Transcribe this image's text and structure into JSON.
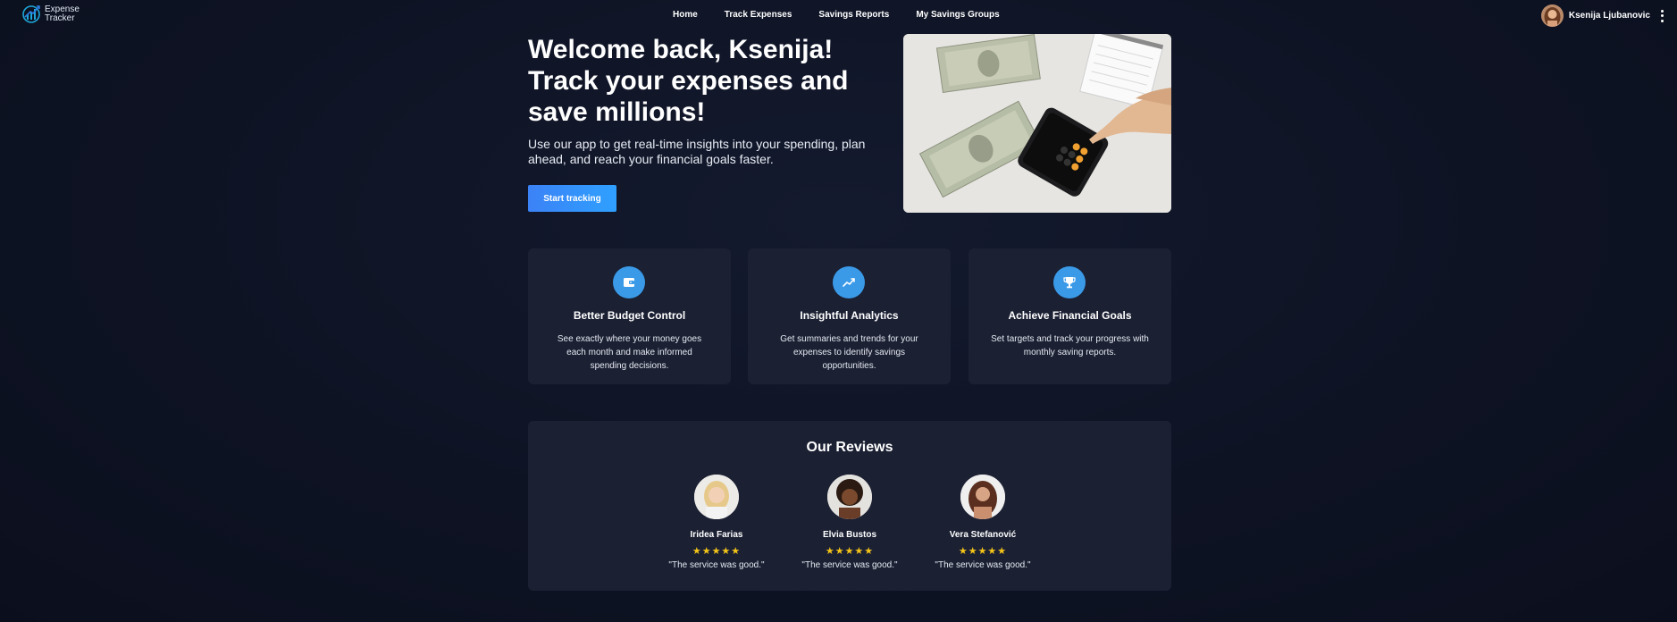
{
  "logo": {
    "line1": "Expense",
    "line2": "Tracker"
  },
  "nav": {
    "links": [
      "Home",
      "Track Expenses",
      "Savings Reports",
      "My Savings Groups"
    ]
  },
  "user": {
    "name": "Ksenija Ljubanovic"
  },
  "hero": {
    "title_lines": [
      "Welcome back, Ksenija!",
      "Track your expenses and",
      "save millions!"
    ],
    "subtitle_lines": [
      "Use our app to get real-time insights into your spending, plan",
      "ahead, and reach your financial goals faster."
    ],
    "cta_label": "Start tracking"
  },
  "features": [
    {
      "icon": "wallet-icon",
      "title": "Better Budget Control",
      "desc_lines": [
        "See exactly where your money goes",
        "each month and make informed",
        "spending decisions."
      ]
    },
    {
      "icon": "trending-up-icon",
      "title": "Insightful Analytics",
      "desc_lines": [
        "Get summaries and trends for your",
        "expenses to identify savings",
        "opportunities."
      ]
    },
    {
      "icon": "trophy-icon",
      "title": "Achieve Financial Goals",
      "desc_lines": [
        "Set targets and track your progress with",
        "monthly saving reports."
      ]
    }
  ],
  "reviews": {
    "title": "Our Reviews",
    "items": [
      {
        "name": "Iridea Farias",
        "stars": "★★★★★",
        "rating": 5,
        "text": "\"The service was good.\""
      },
      {
        "name": "Elvia Bustos",
        "stars": "★★★★★",
        "rating": 5,
        "text": "\"The service was good.\""
      },
      {
        "name": "Vera Stefanović",
        "stars": "★★★★★",
        "rating": 5,
        "text": "\"The service was good.\""
      }
    ]
  },
  "colors": {
    "background": "#0e1324",
    "card": "#1b2033",
    "accent": "#3a9ae8",
    "button": "#2f8cff",
    "star": "#f5c518"
  }
}
